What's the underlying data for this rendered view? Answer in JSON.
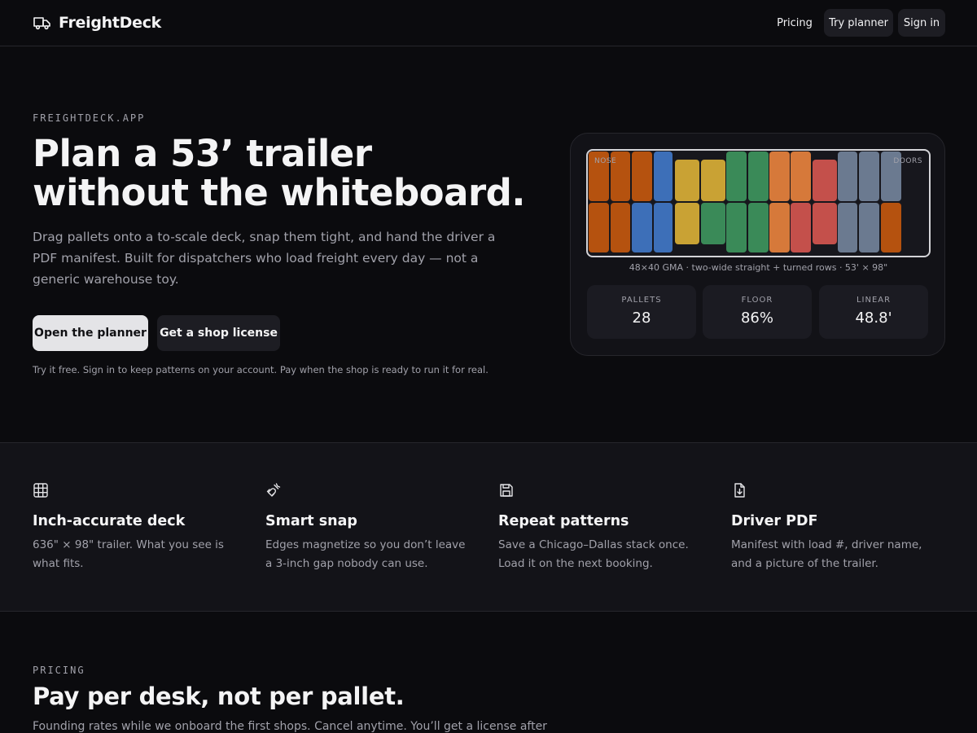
{
  "nav": {
    "brand": "FreightDeck",
    "pricing": "Pricing",
    "try_planner": "Try planner",
    "sign_in": "Sign in"
  },
  "hero": {
    "eyebrow": "FREIGHTDECK.APP",
    "title_line1": "Plan a 53’ trailer",
    "title_line2": "without the whiteboard.",
    "subtitle": "Drag pallets onto a to-scale deck, snap them tight, and hand the driver a PDF manifest. Built for dispatchers who load freight every day — not a generic warehouse toy.",
    "primary_cta": "Open the planner",
    "secondary_cta": "Get a shop license",
    "note": "Try it free. Sign in to keep patterns on your account. Pay when the shop is ready to run it for real."
  },
  "trailer": {
    "nose_label": "NOSE",
    "doors_label": "DOORS",
    "caption": "48×40 GMA · two-wide straight + turned rows · 53' × 98\"",
    "stats": [
      {
        "label": "PALLETS",
        "value": "28"
      },
      {
        "label": "FLOOR",
        "value": "86%"
      },
      {
        "label": "LINEAR",
        "value": "48.8'"
      }
    ]
  },
  "features": [
    {
      "icon": "grid-icon",
      "title": "Inch-accurate deck",
      "body": "636\" × 98\" trailer. What you see is what fits."
    },
    {
      "icon": "magnet-icon",
      "title": "Smart snap",
      "body": "Edges magnetize so you don’t leave a 3-inch gap nobody can use."
    },
    {
      "icon": "save-icon",
      "title": "Repeat patterns",
      "body": "Save a Chicago–Dallas stack once. Load it on the next booking."
    },
    {
      "icon": "file-download-icon",
      "title": "Driver PDF",
      "body": "Manifest with load #, driver name, and a picture of the trailer."
    }
  ],
  "pricing": {
    "eyebrow": "PRICING",
    "title": "Pay per desk, not per pallet.",
    "subtitle": "Founding rates while we onboard the first shops. Cancel anytime. You’ll get a license after"
  },
  "colors": {
    "orange": "#b5520f",
    "blue": "#3d6fb8",
    "yellow": "#c9a234",
    "green": "#3a8a58",
    "coral": "#d6793a",
    "red": "#c4504b",
    "slate": "#6b7a90"
  }
}
